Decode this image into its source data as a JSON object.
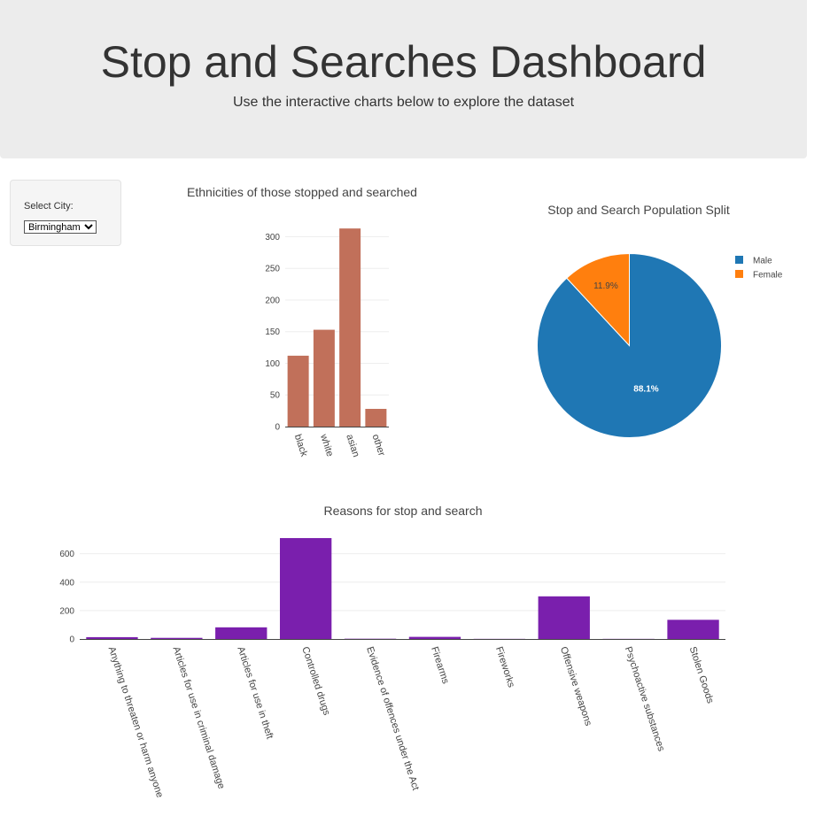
{
  "header": {
    "title": "Stop and Searches Dashboard",
    "subtitle": "Use the interactive charts below to explore the dataset"
  },
  "filters": {
    "city_label": "Select City:",
    "city_options": [
      "Birmingham"
    ],
    "city_selected": "Birmingham"
  },
  "chart_data": [
    {
      "type": "bar",
      "title": "Ethnicities of those stopped and searched",
      "categories": [
        "black",
        "white",
        "asian",
        "other"
      ],
      "values": [
        112,
        153,
        313,
        28
      ],
      "ylim": [
        0,
        330
      ],
      "yticks": [
        0,
        50,
        100,
        150,
        200,
        250,
        300
      ],
      "color": "#c1705a",
      "grid": true
    },
    {
      "type": "pie",
      "title": "Stop and Search Population Split",
      "labels": [
        "Male",
        "Female"
      ],
      "values": [
        88.1,
        11.9
      ],
      "display_labels": [
        "88.1%",
        "11.9%"
      ],
      "colors": [
        "#1f77b4",
        "#ff7f0e"
      ],
      "legend": "right"
    },
    {
      "type": "bar",
      "title": "Reasons for stop and search",
      "categories": [
        "Anything to threaten or harm anyone",
        "Articles for use in criminal damage",
        "Articles for use in theft",
        "Controlled drugs",
        "Evidence of offences under the Act",
        "Firearms",
        "Fireworks",
        "Offensive weapons",
        "Psychoactive substances",
        "Stolen Goods"
      ],
      "values": [
        13,
        8,
        82,
        710,
        2,
        15,
        1,
        300,
        1,
        135
      ],
      "ylim": [
        0,
        660
      ],
      "yticks": [
        0,
        200,
        400,
        600
      ],
      "color": "#7a1fad",
      "grid": true
    }
  ]
}
